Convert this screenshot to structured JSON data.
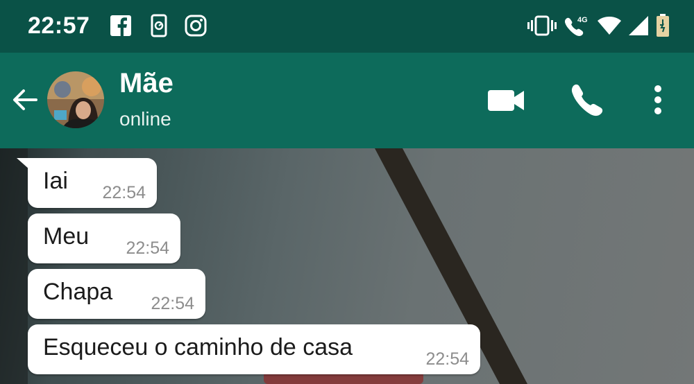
{
  "status_bar": {
    "time": "22:57",
    "notification_icons": [
      "facebook-icon",
      "phone-screen-icon",
      "instagram-icon"
    ],
    "system_icons": [
      "vibrate-icon",
      "volte-4g-icon",
      "wifi-icon",
      "signal-icon",
      "battery-charging-icon"
    ],
    "network_label": "4G"
  },
  "header": {
    "contact_name": "Mãe",
    "contact_status": "online",
    "actions": [
      "video-call-icon",
      "voice-call-icon",
      "more-options-icon"
    ]
  },
  "messages": [
    {
      "text": "Iai",
      "time": "22:54"
    },
    {
      "text": "Meu",
      "time": "22:54"
    },
    {
      "text": "Chapa",
      "time": "22:54"
    },
    {
      "text": "Esqueceu o caminho de casa",
      "time": "22:54"
    }
  ],
  "colors": {
    "status_bar": "#0a5247",
    "header": "#0d6b5b",
    "bubble": "#ffffff",
    "timestamp": "#8d8d8d"
  }
}
